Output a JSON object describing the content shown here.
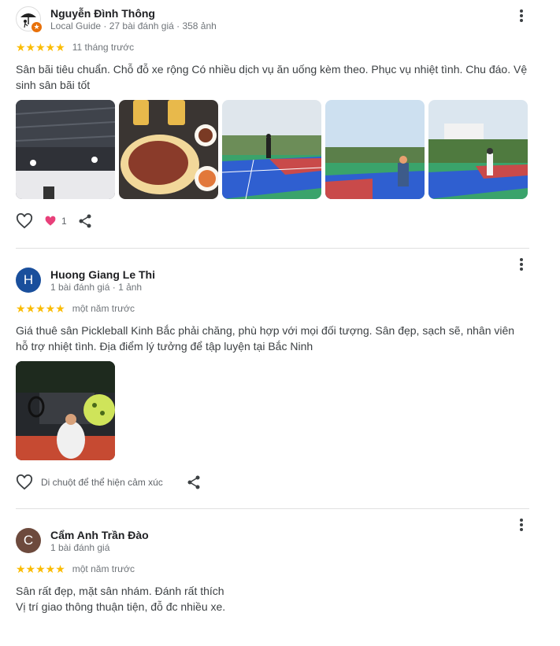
{
  "reviews": [
    {
      "name": "Nguyễn Đình Thông",
      "meta": "Local Guide · 27 bài đánh giá · 358 ảnh",
      "stars": "★★★★★",
      "when": "11 tháng trước",
      "text": "Sân bãi tiêu chuẩn. Chỗ đỗ xe rộng Có nhiều dịch vụ ăn uống kèm theo. Phục vụ nhiệt tình. Chu đáo. Vệ sinh sân bãi tốt",
      "like_count": "1",
      "avatar_icon": "umbrella-person-icon",
      "badge_icon": "local-guide-star-icon"
    },
    {
      "name": "Huong Giang Le Thi",
      "meta": "1 bài đánh giá · 1 ảnh",
      "avatar_letter": "H",
      "avatar_color": "#1a4f9c",
      "stars": "★★★★★",
      "when": "một năm trước",
      "text": "Giá thuê sân Pickleball Kinh Bắc phải chăng, phù hợp với mọi đối tượng. Sân đẹp, sạch sẽ, nhân viên hỗ trợ nhiệt tình. Địa điểm lý tưởng để tập luyện tại Bắc Ninh",
      "react_label": "Di chuột để thể hiện cảm xúc"
    },
    {
      "name": "Cẩm Anh Trần Đào",
      "meta": "1 bài đánh giá",
      "avatar_letter": "C",
      "avatar_color": "#6d4a3d",
      "stars": "★★★★★",
      "when": "một năm trước",
      "text_line1": "Sân rất đẹp, mặt sân nhám. Đánh rất thích",
      "text_line2": "Vị trí giao thông thuận tiện, đỗ đc nhiều xe."
    }
  ],
  "colors": {
    "star": "#fbbc04",
    "heart_reaction": "#e8407a",
    "divider": "#e0e0e0"
  }
}
